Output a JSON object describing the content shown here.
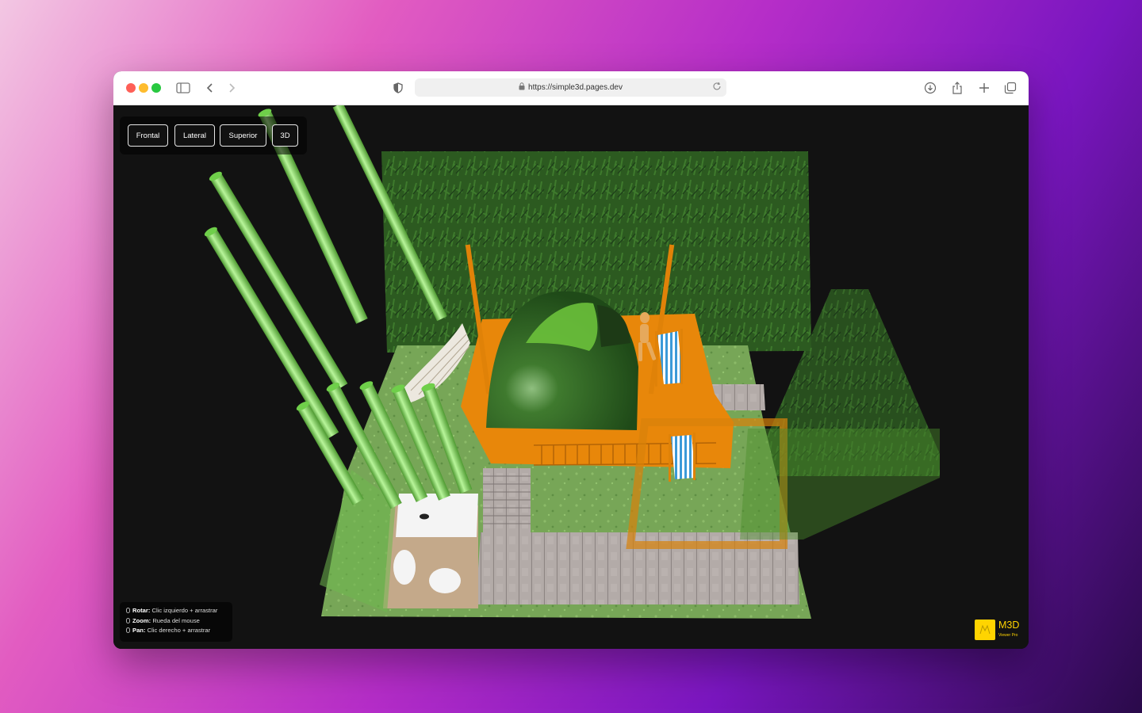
{
  "browser": {
    "url": "https://simple3d.pages.dev"
  },
  "viewer": {
    "view_buttons": [
      {
        "label": "Frontal"
      },
      {
        "label": "Lateral"
      },
      {
        "label": "Superior"
      },
      {
        "label": "3D"
      }
    ],
    "controls_help": [
      {
        "action": "Rotar:",
        "desc": "Clic izquierdo + arrastrar"
      },
      {
        "action": "Zoom:",
        "desc": "Rueda del mouse"
      },
      {
        "action": "Pan:",
        "desc": "Clic derecho + arrastrar"
      }
    ],
    "logo": {
      "title": "M3D",
      "subtitle": "Viewer Pro"
    }
  },
  "colors": {
    "accent": "#ffd400",
    "deck": "#e8870a",
    "grass": "#79a85a",
    "hedge": "#2f5a22",
    "tent": "#2d5a1f",
    "bamboo": "#8fe06a"
  }
}
